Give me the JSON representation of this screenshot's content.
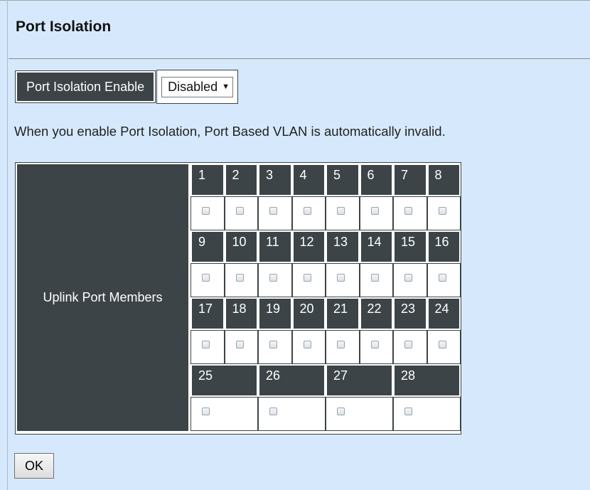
{
  "page": {
    "title": "Port Isolation",
    "notice": "When you enable Port Isolation, Port Based VLAN is automatically invalid."
  },
  "enable": {
    "label": "Port Isolation Enable",
    "selected": "Disabled",
    "options": [
      "Disabled"
    ]
  },
  "uplink": {
    "label": "Uplink Port Members",
    "rows": [
      [
        "1",
        "2",
        "3",
        "4",
        "5",
        "6",
        "7",
        "8"
      ],
      [
        "9",
        "10",
        "11",
        "12",
        "13",
        "14",
        "15",
        "16"
      ],
      [
        "17",
        "18",
        "19",
        "20",
        "21",
        "22",
        "23",
        "24"
      ],
      [
        "25",
        "26",
        "27",
        "28"
      ]
    ],
    "checked": []
  },
  "actions": {
    "ok_label": "OK"
  }
}
